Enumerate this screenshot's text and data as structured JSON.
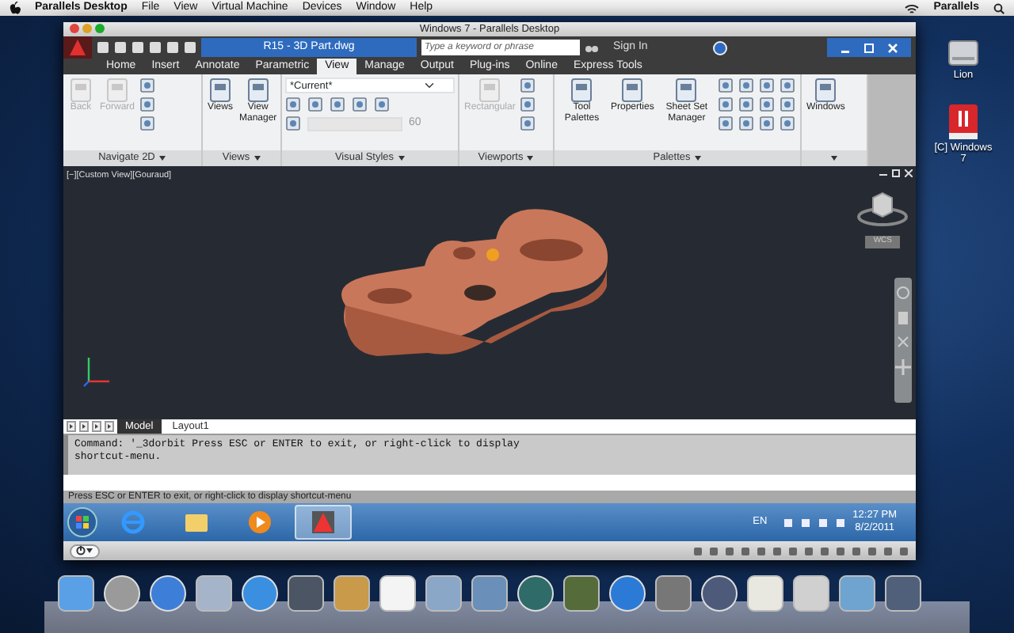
{
  "menubar": {
    "app_name": "Parallels Desktop",
    "items": [
      "File",
      "View",
      "Virtual Machine",
      "Devices",
      "Window",
      "Help"
    ],
    "right_label": "Parallels"
  },
  "window": {
    "title": "Windows 7 - Parallels Desktop"
  },
  "autocad": {
    "document_title": "R15 - 3D Part.dwg",
    "search": {
      "placeholder": "Type a keyword or phrase"
    },
    "sign_in": "Sign In"
  },
  "ribbon_tabs": [
    {
      "label": "Home",
      "selected": false
    },
    {
      "label": "Insert",
      "selected": false
    },
    {
      "label": "Annotate",
      "selected": false
    },
    {
      "label": "Parametric",
      "selected": false
    },
    {
      "label": "View",
      "selected": true
    },
    {
      "label": "Manage",
      "selected": false
    },
    {
      "label": "Output",
      "selected": false
    },
    {
      "label": "Plug-ins",
      "selected": false
    },
    {
      "label": "Online",
      "selected": false
    },
    {
      "label": "Express Tools",
      "selected": false
    }
  ],
  "ribbon_panels": [
    {
      "kind": "navigate",
      "title": "Navigate 2D",
      "buttons": [
        {
          "label": "Back",
          "disabled": true
        },
        {
          "label": "Forward",
          "disabled": true
        }
      ]
    },
    {
      "kind": "views",
      "title": "Views",
      "buttons": [
        {
          "label": "Views",
          "disabled": false
        },
        {
          "label": "View Manager",
          "disabled": false
        }
      ]
    },
    {
      "kind": "visual_styles",
      "title": "Visual Styles",
      "dropdown": "*Current*",
      "opacity_field": {
        "disabled": true
      },
      "opacity_value": "60"
    },
    {
      "kind": "viewports",
      "title": "Viewports",
      "buttons": [
        {
          "label": "Rectangular",
          "disabled": true
        }
      ]
    },
    {
      "kind": "palettes",
      "title": "Palettes",
      "buttons": [
        {
          "label": "Tool Palettes",
          "disabled": false
        },
        {
          "label": "Properties",
          "disabled": false
        },
        {
          "label": "Sheet Set Manager",
          "disabled": false
        }
      ]
    },
    {
      "kind": "windows",
      "buttons": [
        {
          "label": "Windows",
          "disabled": false
        }
      ]
    }
  ],
  "viewport": {
    "label": "[−][Custom View][Gouraud]",
    "wcs_label": "WCS"
  },
  "layout_tabs": [
    {
      "label": "Model",
      "selected": true
    },
    {
      "label": "Layout1",
      "selected": false
    }
  ],
  "command_lines": [
    "Command: '_3dorbit Press ESC or ENTER to exit, or right-click to display",
    "shortcut-menu."
  ],
  "status_text": "Press ESC or ENTER to exit, or right-click to display shortcut-menu",
  "taskbar": {
    "apps": [
      {
        "kind": "browser",
        "selected": false
      },
      {
        "kind": "folder",
        "selected": false
      },
      {
        "kind": "media",
        "selected": false
      },
      {
        "kind": "cad",
        "selected": true
      }
    ],
    "language": "EN",
    "time": "12:27 PM",
    "date": "8/2/2011"
  },
  "desktop_icons": [
    {
      "kind": "drive",
      "label": "Lion"
    },
    {
      "kind": "vm",
      "label": "[C] Windows 7"
    }
  ]
}
